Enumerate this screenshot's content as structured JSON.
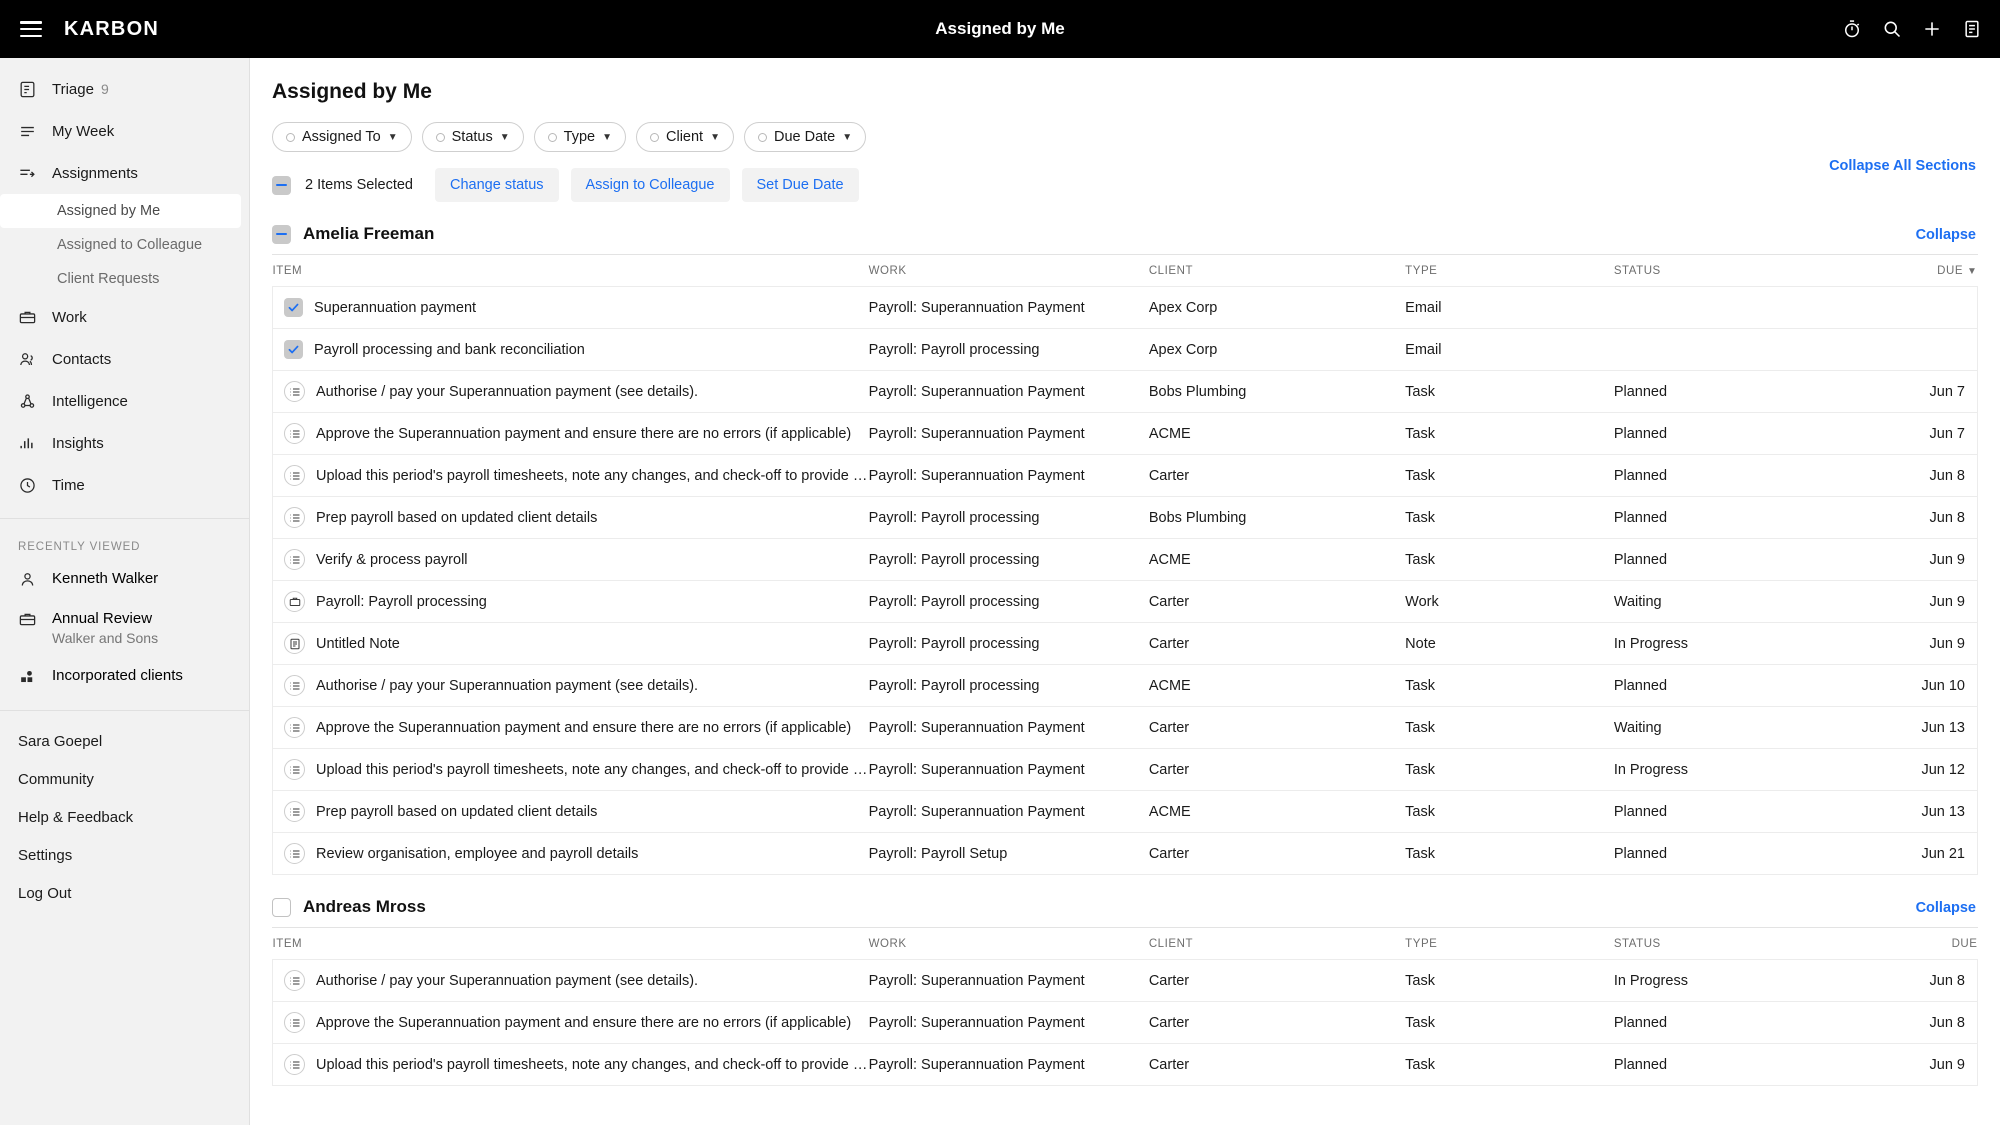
{
  "topbar": {
    "brand": "KARBON",
    "title": "Assigned by Me",
    "menu_icon": "hamburger-icon",
    "icons": [
      "timer-icon",
      "search-icon",
      "plus-icon",
      "notes-icon"
    ]
  },
  "sidebar": {
    "nav": [
      {
        "label": "Triage",
        "icon": "triage-icon",
        "count": "9"
      },
      {
        "label": "My Week",
        "icon": "my-week-icon",
        "count": ""
      },
      {
        "label": "Assignments",
        "icon": "assignments-icon",
        "count": ""
      }
    ],
    "subnav": [
      {
        "label": "Assigned by Me",
        "active": true
      },
      {
        "label": "Assigned to Colleague",
        "active": false
      },
      {
        "label": "Client Requests",
        "active": false
      }
    ],
    "nav2": [
      {
        "label": "Work",
        "icon": "briefcase-icon"
      },
      {
        "label": "Contacts",
        "icon": "contacts-icon"
      },
      {
        "label": "Intelligence",
        "icon": "intelligence-icon"
      },
      {
        "label": "Insights",
        "icon": "insights-icon"
      },
      {
        "label": "Time",
        "icon": "clock-icon"
      }
    ],
    "recently_viewed_label": "RECENTLY VIEWED",
    "recent": [
      {
        "title": "Kenneth Walker",
        "sub": "",
        "icon": "person-icon"
      },
      {
        "title": "Annual Review",
        "sub": "Walker and Sons",
        "icon": "briefcase-icon"
      },
      {
        "title": "Incorporated clients",
        "sub": "",
        "icon": "group-icon"
      }
    ],
    "bottom": [
      {
        "label": "Sara Goepel"
      },
      {
        "label": "Community"
      },
      {
        "label": "Help & Feedback"
      },
      {
        "label": "Settings"
      },
      {
        "label": "Log Out"
      }
    ]
  },
  "main": {
    "page_title": "Assigned by Me",
    "collapse_all_label": "Collapse All Sections",
    "filters": [
      {
        "label": "Assigned To"
      },
      {
        "label": "Status"
      },
      {
        "label": "Type"
      },
      {
        "label": "Client"
      },
      {
        "label": "Due Date"
      }
    ],
    "toolbar": {
      "selection_text": "2 Items Selected",
      "checkbox_state": "indeterminate",
      "buttons": [
        {
          "label": "Change status"
        },
        {
          "label": "Assign to Colleague"
        },
        {
          "label": "Set Due Date"
        }
      ]
    },
    "columns": [
      "ITEM",
      "WORK",
      "CLIENT",
      "TYPE",
      "STATUS",
      "DUE"
    ],
    "sections": [
      {
        "name": "Amelia Freeman",
        "checkbox_state": "indeterminate",
        "collapse_label": "Collapse",
        "due_sorted": true,
        "sort_arrow": "▼",
        "rows": [
          {
            "icon": "checkbox-checked",
            "item": "Superannuation payment",
            "work": "Payroll: Superannuation Payment",
            "client": "Apex Corp",
            "type": "Email",
            "status": "",
            "due": ""
          },
          {
            "icon": "checkbox-checked",
            "item": "Payroll processing and bank reconciliation",
            "work": "Payroll: Payroll processing",
            "client": "Apex Corp",
            "type": "Email",
            "status": "",
            "due": ""
          },
          {
            "icon": "task-icon",
            "item": "Authorise / pay your Superannuation payment (see details).",
            "work": "Payroll: Superannuation Payment",
            "client": "Bobs Plumbing",
            "type": "Task",
            "status": "Planned",
            "due": "Jun 7"
          },
          {
            "icon": "task-icon",
            "item": "Approve the Superannuation payment and ensure there are no errors (if applicable)",
            "work": "Payroll: Superannuation Payment",
            "client": "ACME",
            "type": "Task",
            "status": "Planned",
            "due": "Jun 7"
          },
          {
            "icon": "task-icon",
            "item": "Upload this period's payroll timesheets, note any changes, and check-off to provide …",
            "work": "Payroll: Superannuation Payment",
            "client": "Carter",
            "type": "Task",
            "status": "Planned",
            "due": "Jun 8"
          },
          {
            "icon": "task-icon",
            "item": "Prep payroll based on updated client details",
            "work": "Payroll: Payroll processing",
            "client": "Bobs Plumbing",
            "type": "Task",
            "status": "Planned",
            "due": "Jun 8"
          },
          {
            "icon": "task-icon",
            "item": "Verify & process payroll",
            "work": "Payroll: Payroll processing",
            "client": "ACME",
            "type": "Task",
            "status": "Planned",
            "due": "Jun 9"
          },
          {
            "icon": "work-icon",
            "item": "Payroll: Payroll processing",
            "work": "Payroll: Payroll processing",
            "client": "Carter",
            "type": "Work",
            "status": "Waiting",
            "due": "Jun 9"
          },
          {
            "icon": "note-icon",
            "item": "Untitled Note",
            "work": "Payroll: Payroll processing",
            "client": "Carter",
            "type": "Note",
            "status": "In Progress",
            "due": "Jun 9"
          },
          {
            "icon": "task-icon",
            "item": "Authorise / pay your Superannuation payment (see details).",
            "work": "Payroll: Payroll processing",
            "client": "ACME",
            "type": "Task",
            "status": "Planned",
            "due": "Jun 10"
          },
          {
            "icon": "task-icon",
            "item": "Approve the Superannuation payment and ensure there are no errors (if applicable)",
            "work": "Payroll: Superannuation Payment",
            "client": "Carter",
            "type": "Task",
            "status": "Waiting",
            "due": "Jun 13"
          },
          {
            "icon": "task-icon",
            "item": "Upload this period's payroll timesheets, note any changes, and check-off to provide …",
            "work": "Payroll: Superannuation Payment",
            "client": "Carter",
            "type": "Task",
            "status": "In Progress",
            "due": "Jun 12"
          },
          {
            "icon": "task-icon",
            "item": "Prep payroll based on updated client details",
            "work": "Payroll: Superannuation Payment",
            "client": "ACME",
            "type": "Task",
            "status": "Planned",
            "due": "Jun 13"
          },
          {
            "icon": "task-icon",
            "item": "Review organisation, employee and payroll details",
            "work": "Payroll: Payroll Setup",
            "client": "Carter",
            "type": "Task",
            "status": "Planned",
            "due": "Jun 21"
          }
        ]
      },
      {
        "name": "Andreas Mross",
        "checkbox_state": "empty",
        "collapse_label": "Collapse",
        "due_sorted": false,
        "sort_arrow": "",
        "rows": [
          {
            "icon": "task-icon",
            "item": "Authorise / pay your Superannuation payment (see details).",
            "work": "Payroll: Superannuation Payment",
            "client": "Carter",
            "type": "Task",
            "status": "In Progress",
            "due": "Jun 8"
          },
          {
            "icon": "task-icon",
            "item": "Approve the Superannuation payment and ensure there are no errors (if applicable)",
            "work": "Payroll: Superannuation Payment",
            "client": "Carter",
            "type": "Task",
            "status": "Planned",
            "due": "Jun 8"
          },
          {
            "icon": "task-icon",
            "item": "Upload this period's payroll timesheets, note any changes, and check-off to provide …",
            "work": "Payroll: Superannuation Payment",
            "client": "Carter",
            "type": "Task",
            "status": "Planned",
            "due": "Jun 9"
          }
        ]
      }
    ]
  },
  "colors": {
    "accent": "#1d6ff2",
    "topbar_bg": "#000000",
    "sidebar_bg": "#f2f2f2"
  }
}
